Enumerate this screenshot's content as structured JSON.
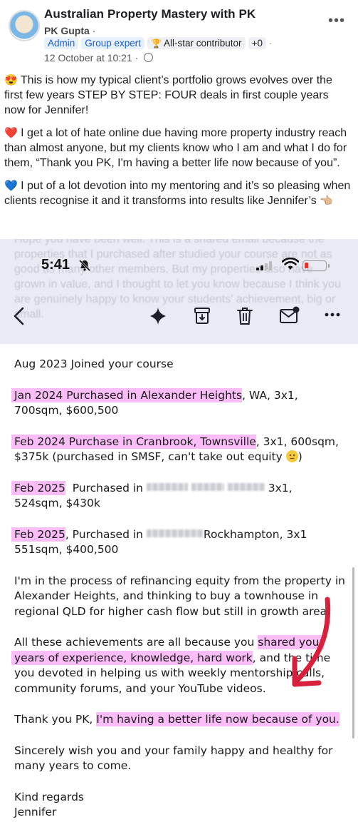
{
  "post": {
    "group_name": "Australian Property Mastery with PK",
    "author": "PK Gupta",
    "author_suffix": "·",
    "badges": [
      "Admin",
      "Group expert",
      "All-star contributor",
      "+0"
    ],
    "date": "12 October at 10:21",
    "date_sep": "·",
    "paragraphs": [
      {
        "emoji": "😍",
        "text": "This is how my typical client’s portfolio grows evolves over the first few years STEP BY STEP: FOUR deals in first couple years now for Jennifer!"
      },
      {
        "emoji": "❤️",
        "text": "I get a lot of hate online due having more property industry reach than almost anyone, but my clients know who I am and what I do for them, “Thank you PK, I'm having a better life now because of you”."
      },
      {
        "emoji": "💙",
        "text": "I put of a lot devotion into my mentoring and it’s so pleasing when clients recognise it and it transforms into results like Jennifer’s",
        "trail_emoji": "👈🏼"
      }
    ]
  },
  "status_bar": {
    "time": "5:41",
    "battery_color": "#e5322c"
  },
  "ghost_text": "Hope you have been well. This is a shared email because the properties that I purchased after studied your course are not as good as many other members. But my properties also have grown in value, and I thought to let you know because I think you are genuinely happy to know your students' achievement, big or small.",
  "toolbar_icons": [
    "back-icon",
    "sparkle-icon",
    "archive-icon",
    "trash-icon",
    "mail-icon",
    "more-icon"
  ],
  "email": {
    "line_joined": "Aug 2023 Joined your course",
    "p2_hl": "Jan 2024 Purchased in Alexander Heights",
    "p2_rest": ", WA, 3x1,",
    "p2_line2": "700sqm, $600,500",
    "p3_hl": "Feb 2024 Purchase in Cranbrook, Townsville",
    "p3_rest": ", 3x1, 600sqm,",
    "p3_line2": "$375k (purchased in SMSF, can't take out equity",
    "p3_close": ")",
    "p4_hl": "Feb 2025",
    "p4_rest": "Purchased in",
    "p4_tail": "3x1,",
    "p4_line2": "524sqm, $430k",
    "p5_hl": "Feb 2025",
    "p5_rest": ", Purchased in",
    "p5_tail": "Rockhampton, 3x1",
    "p5_line2": "551sqm, $400,500",
    "p6": "I'm in the process of refinancing equity from the property in Alexander Heights, and thinking to buy a townhouse in regional QLD for higher cash flow but still in growth area.",
    "p7_a": "All these achievements are all because you ",
    "p7_hl1": "shared your",
    "p7_hl2": "years of experience, knowledge, hard work",
    "p7_b": ", and the time you devoted in helping us with weekly mentorship calls, community forums, and your YouTube videos.",
    "p8_a": "Thank you PK, ",
    "p8_hl": "I'm having a better life now because of you.",
    "p9": "Sincerely wish you and your family happy and healthy for many years to come.",
    "sign_off": "Kind regards",
    "signature": "Jennifer"
  },
  "colors": {
    "highlight": "#f587f0",
    "arrow": "#d8203c",
    "badge_blue": "#1b5fd1"
  }
}
